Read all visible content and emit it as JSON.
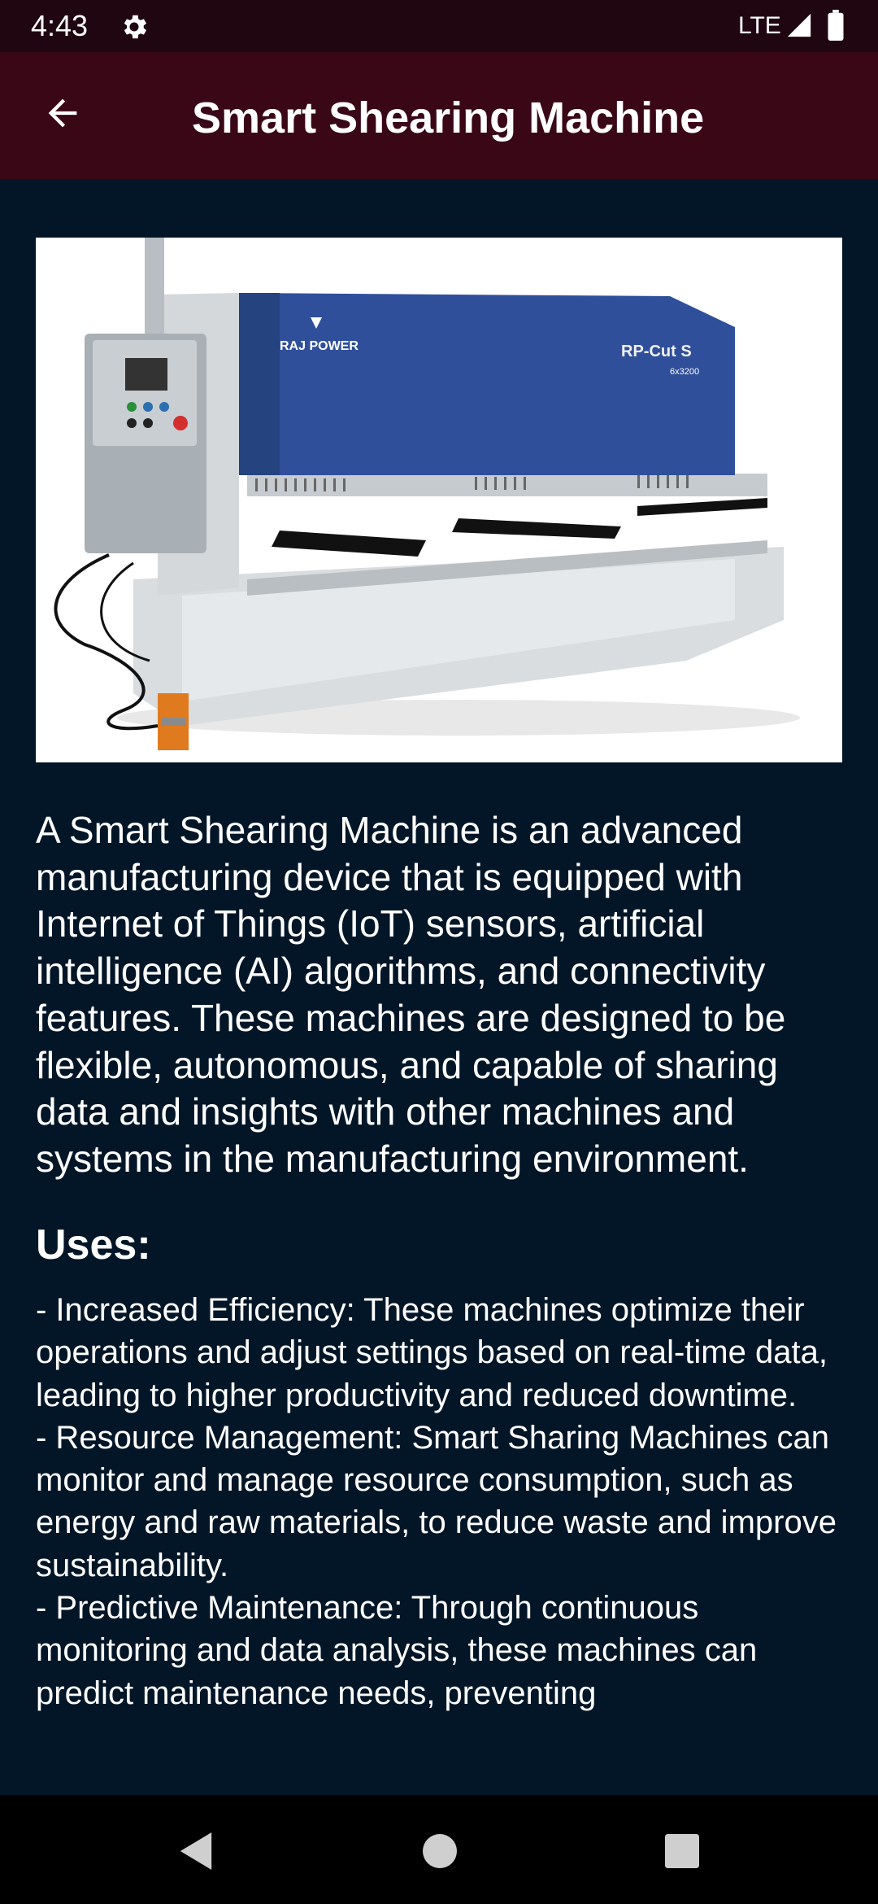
{
  "status_bar": {
    "time": "4:43",
    "network": "LTE",
    "icons": [
      "gear-icon",
      "signal-icon",
      "battery-icon"
    ]
  },
  "app_bar": {
    "title": "Smart Shearing Machine",
    "back_icon": "arrow-left-icon"
  },
  "hero_image": {
    "brand": "RAJ POWER",
    "model": "RP-Cut S",
    "model_sub": "6x3200"
  },
  "content": {
    "description": "A Smart Shearing Machine is an advanced manufacturing device that is equipped with Internet of Things (IoT) sensors, artificial intelligence (AI) algorithms, and connectivity features. These machines are designed to be flexible, autonomous, and capable of sharing data and insights with other machines and systems in the manufacturing environment.",
    "uses_heading": "Uses:",
    "uses": [
      "- Increased Efficiency: These machines optimize their operations and adjust settings based on real-time data, leading to higher productivity and reduced downtime.",
      "- Resource Management: Smart Sharing Machines can monitor and manage resource consumption, such as energy and raw materials, to reduce waste and improve sustainability.",
      "- Predictive Maintenance: Through continuous monitoring and data analysis, these machines can predict maintenance needs, preventing"
    ]
  },
  "nav_bar": {
    "icons": [
      "nav-back-icon",
      "nav-home-icon",
      "nav-recents-icon"
    ]
  },
  "colors": {
    "status_bar": "#1f0610",
    "app_bar": "#3a0716",
    "background": "#031627",
    "text": "#ffffff",
    "machine_blue": "#2f4f9a"
  }
}
